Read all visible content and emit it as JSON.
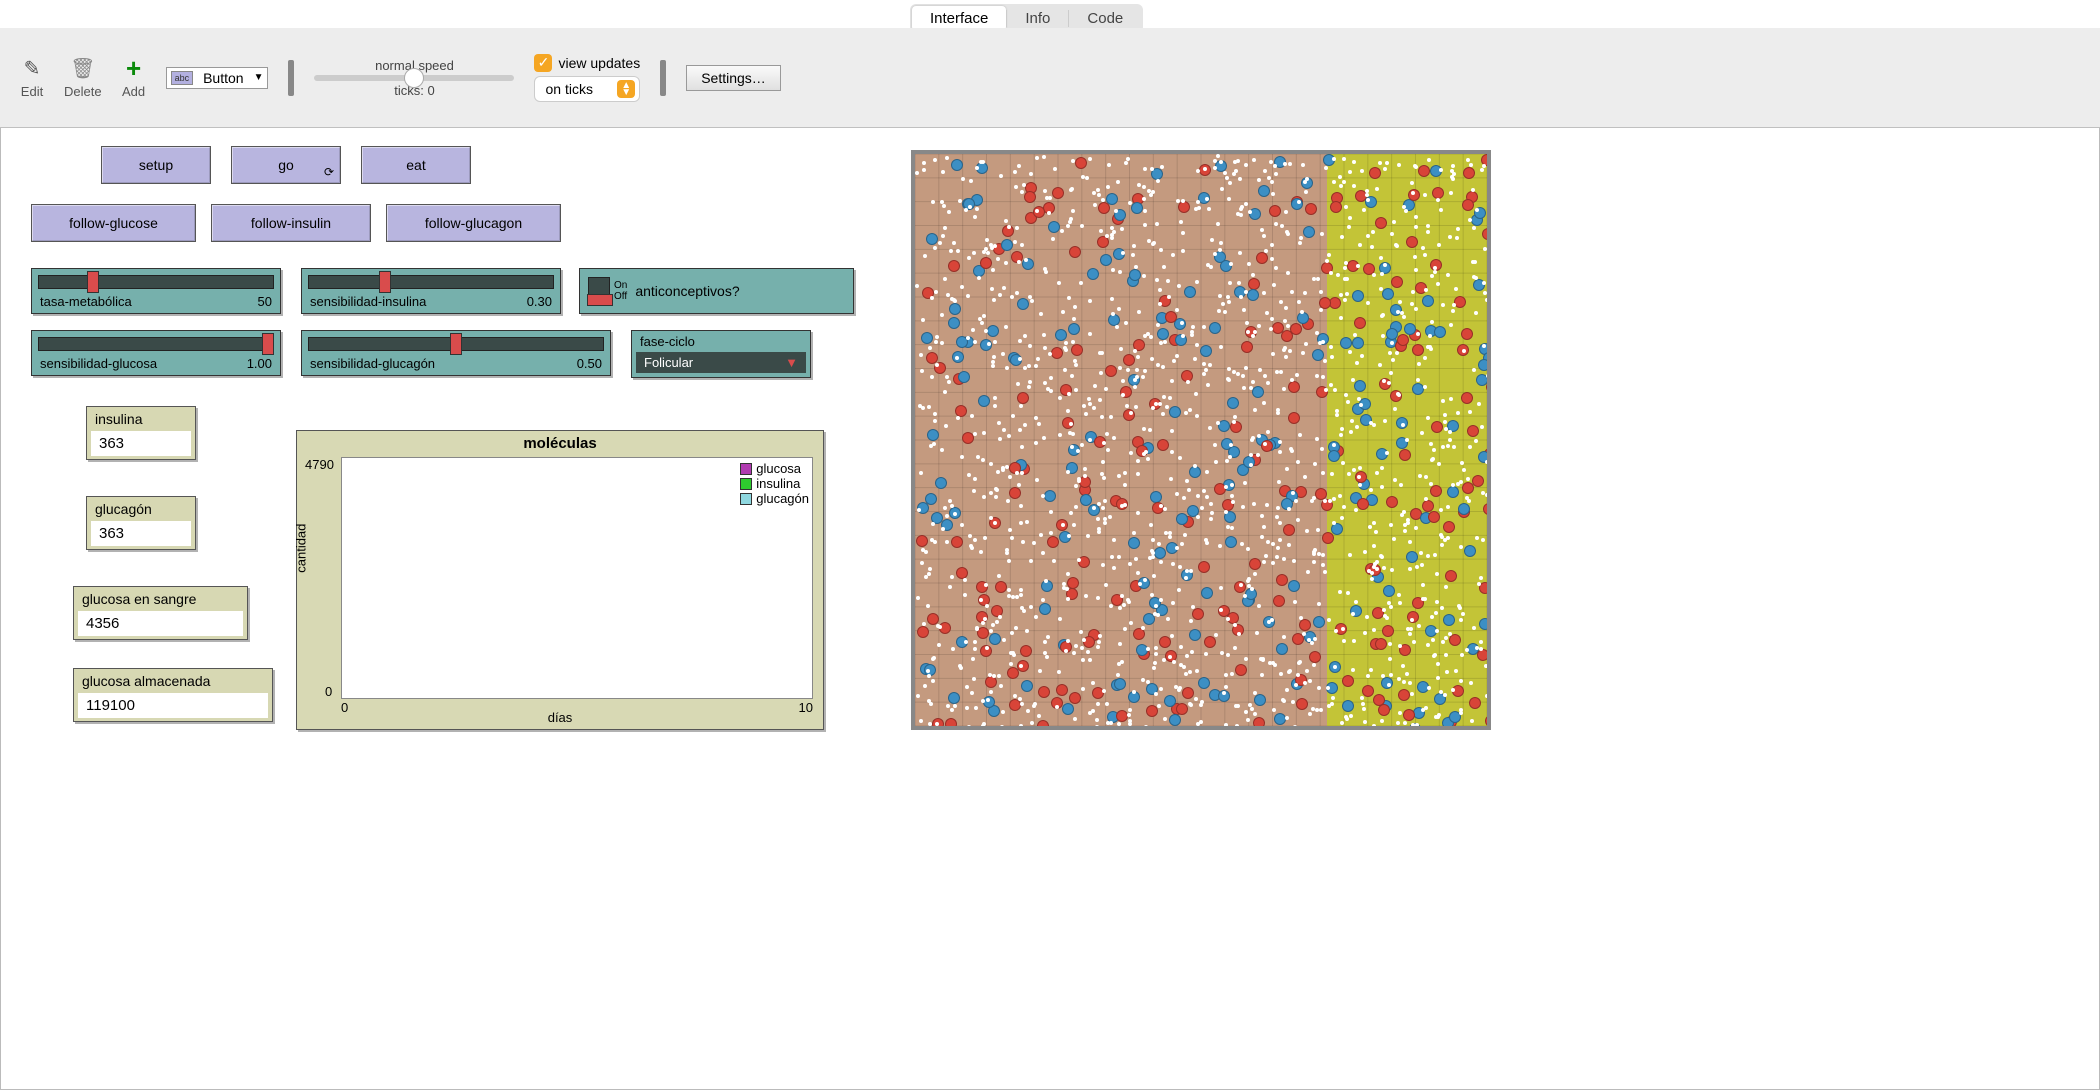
{
  "tabs": {
    "interface": "Interface",
    "info": "Info",
    "code": "Code",
    "active": "interface"
  },
  "toolbar": {
    "edit": "Edit",
    "delete": "Delete",
    "add": "Add",
    "widget_picker": "Button",
    "speed_label": "normal speed",
    "ticks_label": "ticks:",
    "ticks_value": "0",
    "view_updates": "view updates",
    "view_updates_checked": true,
    "update_mode": "on ticks",
    "settings": "Settings…"
  },
  "buttons": {
    "setup": "setup",
    "go": "go",
    "eat": "eat",
    "follow_glucose": "follow-glucose",
    "follow_insulin": "follow-insulin",
    "follow_glucagon": "follow-glucagon"
  },
  "sliders": {
    "tasa": {
      "label": "tasa-metabólica",
      "value": "50",
      "pos": 0.22
    },
    "sens_insulina": {
      "label": "sensibilidad-insulina",
      "value": "0.30",
      "pos": 0.3
    },
    "sens_glucosa": {
      "label": "sensibilidad-glucosa",
      "value": "1.00",
      "pos": 1.0
    },
    "sens_glucagon": {
      "label": "sensibilidad-glucagón",
      "value": "0.50",
      "pos": 0.5
    }
  },
  "switch": {
    "label": "anticonceptivos?",
    "on": "On",
    "off": "Off",
    "value": false
  },
  "chooser": {
    "label": "fase-ciclo",
    "value": "Folicular"
  },
  "monitors": {
    "insulina": {
      "label": "insulina",
      "value": "363"
    },
    "glucagon": {
      "label": "glucagón",
      "value": "363"
    },
    "glucosa_sangre": {
      "label": "glucosa en sangre",
      "value": "4356"
    },
    "glucosa_alm": {
      "label": "glucosa almacenada",
      "value": "119100"
    }
  },
  "plot": {
    "title": "moléculas",
    "ylabel": "cantidad",
    "xlabel": "días",
    "ymin": "0",
    "ymax": "4790",
    "xmin": "0",
    "xmax": "10",
    "legend": [
      {
        "name": "glucosa",
        "color": "#b03ab0"
      },
      {
        "name": "insulina",
        "color": "#2ecc2e"
      },
      {
        "name": "glucagón",
        "color": "#8fd8e0"
      }
    ]
  },
  "chart_data": {
    "type": "line",
    "title": "moléculas",
    "xlabel": "días",
    "ylabel": "cantidad",
    "xlim": [
      0,
      10
    ],
    "ylim": [
      0,
      4790
    ],
    "series": [
      {
        "name": "glucosa",
        "color": "#b03ab0",
        "x": [],
        "y": []
      },
      {
        "name": "insulina",
        "color": "#2ecc2e",
        "x": [],
        "y": []
      },
      {
        "name": "glucagón",
        "color": "#8fd8e0",
        "x": [],
        "y": []
      }
    ]
  },
  "world": {
    "agent_colors": {
      "red": "#d84438",
      "blue": "#3c8fc4",
      "white": "#ffffff"
    }
  }
}
